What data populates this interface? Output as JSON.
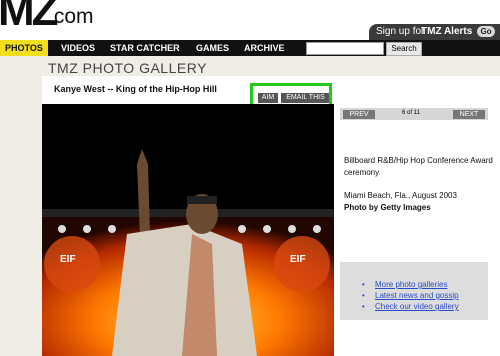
{
  "brand": {
    "logo_big": "MZ",
    "logo_com": ".com"
  },
  "header": {
    "signup_prefix": "Sign up for",
    "signup_strong": "TMZ Alerts",
    "go_label": "Go"
  },
  "nav": {
    "tabs": [
      "PHOTOS",
      "VIDEOS",
      "STAR CATCHER",
      "GAMES",
      "ARCHIVE"
    ],
    "search_value": "",
    "search_button": "Search"
  },
  "gallery": {
    "title": "TMZ PHOTO GALLERY",
    "heading": "Kanye West -- King of the Hip-Hop Hill",
    "share": {
      "aim": "AIM",
      "email": "EMAIL THIS"
    },
    "pager": {
      "prev": "PREV",
      "count": "6 of 11",
      "next": "NEXT"
    },
    "caption": "Billboard R&B/Hip Hop Conference Award ceremony",
    "location": "Miami Beach, Fla., August 2003",
    "credit": "Photo by Getty Images",
    "photo_text": "EIF",
    "links": [
      "More photo galleries",
      "Latest news and gossip",
      "Check our video gallery"
    ]
  },
  "colors": {
    "nav_active": "#f3de1c",
    "highlight": "#22c81d",
    "link": "#2a4cc8"
  }
}
